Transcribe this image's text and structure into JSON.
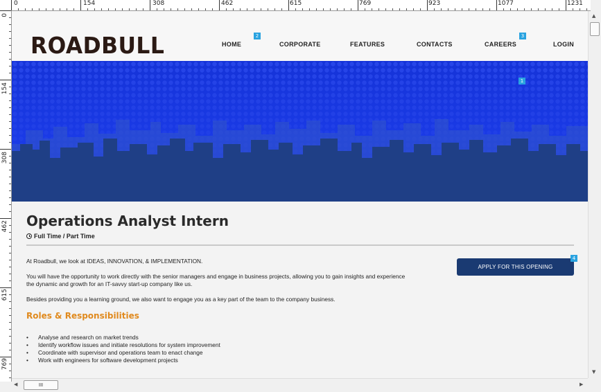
{
  "ruler": {
    "top_labels": [
      "0",
      "154",
      "308",
      "462",
      "615",
      "769",
      "923",
      "1077",
      "1231"
    ],
    "left_labels": [
      "0",
      "154",
      "308",
      "462",
      "615",
      "769"
    ]
  },
  "header": {
    "logo_text": "ROADBULL",
    "nav": [
      {
        "label": "HOME"
      },
      {
        "label": "CORPORATE"
      },
      {
        "label": "FEATURES"
      },
      {
        "label": "CONTACTS"
      },
      {
        "label": "CAREERS"
      },
      {
        "label": "LOGIN"
      }
    ]
  },
  "markers": [
    "2",
    "3",
    "1",
    "4"
  ],
  "job": {
    "title": "Operations Analyst Intern",
    "type": "Full Time / Part Time",
    "intro": "At Roadbull, we look at IDEAS, INNOVATION, & IMPLEMENTATION.",
    "para2": "You will have the opportunity to work directly with the senior managers and engage in business projects, allowing you to gain insights and experience the dynamic and growth for an IT-savvy start-up company like us.",
    "para3": "Besides providing you a learning ground, we also want to engage you as a key part of the team to the company business.",
    "apply_label": "APPLY FOR THIS OPENING",
    "section_title": "Roles & Responsibilities",
    "responsibilities": [
      "Analyse and research on market trends",
      "Identify workflow issues and initiate resolutions for system improvement",
      "Coordinate with supervisor and operations team to enact change",
      "Work with engineers for software development projects"
    ]
  },
  "scrollbar": {
    "hthumb_grip": "III",
    "up_arrow": "▲",
    "down_arrow": "▼",
    "left_arrow": "◀",
    "right_arrow": "▶"
  },
  "colors": {
    "hero_blue": "#1533d8",
    "skyline": "#1f3f86",
    "accent_orange": "#e08a1e",
    "button_navy": "#1a3a72",
    "marker_blue": "#2aa3e0"
  }
}
